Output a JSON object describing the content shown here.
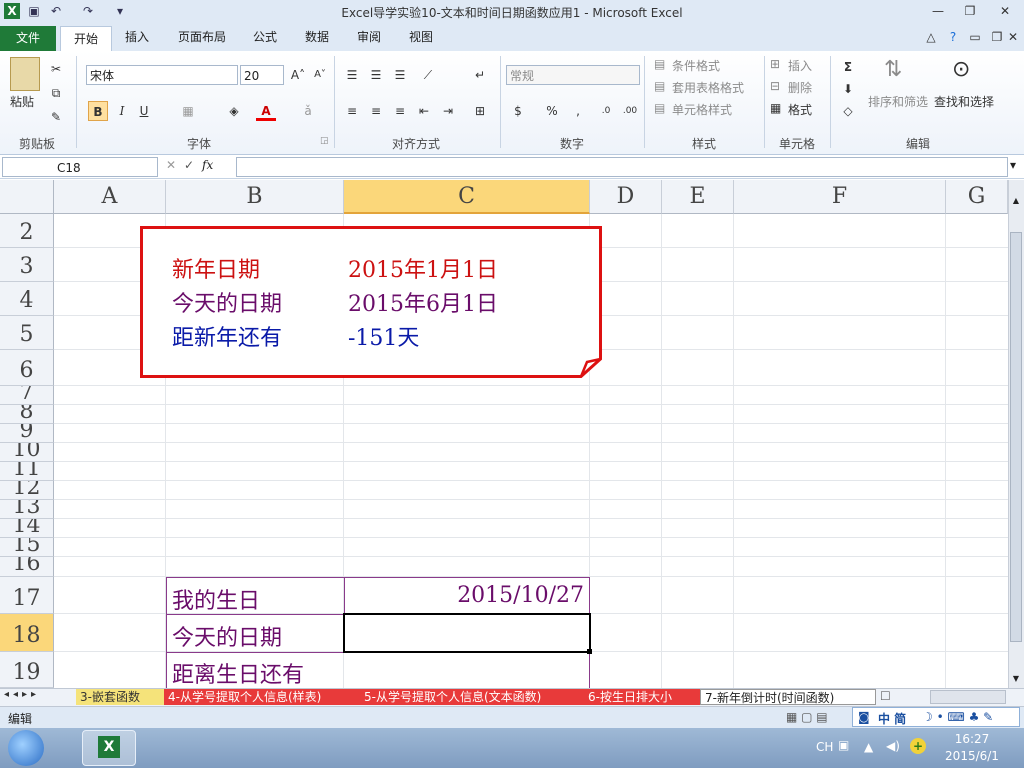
{
  "window": {
    "title": "Excel导学实验10-文本和时间日期函数应用1 - Microsoft Excel"
  },
  "ribbon_tabs": [
    "文件",
    "开始",
    "插入",
    "页面布局",
    "公式",
    "数据",
    "审阅",
    "视图"
  ],
  "ribbon": {
    "clipboard": {
      "label": "剪贴板",
      "paste": "粘贴"
    },
    "font": {
      "label": "字体",
      "name": "宋体",
      "size": "20",
      "bold": "B",
      "italic": "I",
      "underline": "U"
    },
    "alignment": {
      "label": "对齐方式"
    },
    "number": {
      "label": "数字",
      "format": "常规",
      "percent": "%"
    },
    "styles": {
      "label": "样式",
      "conditional": "条件格式",
      "table": "套用表格格式",
      "cell_styles": "单元格样式"
    },
    "cells": {
      "label": "单元格",
      "insert": "插入",
      "delete": "删除",
      "format": "格式"
    },
    "editing": {
      "label": "编辑",
      "sort": "排序和筛选",
      "find": "查找和选择"
    }
  },
  "formula_bar": {
    "name_box": "C18",
    "fx": "fx",
    "value": ""
  },
  "columns": [
    "A",
    "B",
    "C",
    "D",
    "E",
    "F",
    "G"
  ],
  "rows": [
    "2",
    "3",
    "4",
    "5",
    "6",
    "7",
    "8",
    "9",
    "10",
    "11",
    "12",
    "13",
    "14",
    "15",
    "16",
    "17",
    "18",
    "19"
  ],
  "callout": {
    "rows": [
      {
        "label": "新年日期",
        "value": "2015年1月1日",
        "color": "#cc1111"
      },
      {
        "label": "今天的日期",
        "value": "2015年6月1日",
        "color": "#6a0d6a"
      },
      {
        "label": "距新年还有",
        "value": "-151天",
        "color": "#0a1aa8"
      }
    ],
    "border_color": "#dd1111"
  },
  "table": {
    "color": "#6a0d6a",
    "rows": [
      {
        "label": "我的生日",
        "value": "2015/10/27"
      },
      {
        "label": "今天的日期",
        "value": ""
      },
      {
        "label": "距离生日还有",
        "value": ""
      }
    ]
  },
  "sheet_tabs": [
    {
      "label": "3-嵌套函数",
      "color": "#f5e37a",
      "active": false
    },
    {
      "label": "4-从学号提取个人信息(样表)",
      "color": "#e83a3a",
      "active": false
    },
    {
      "label": "5-从学号提取个人信息(文本函数)",
      "color": "#e83a3a",
      "active": false
    },
    {
      "label": "6-按生日排大小",
      "color": "#e83a3a",
      "active": false
    },
    {
      "label": "7-新年倒计时(时间函数)",
      "color": "#ffffff",
      "active": true
    }
  ],
  "status": {
    "mode": "编辑",
    "ime": "中 简"
  },
  "taskbar": {
    "lang": "CH",
    "time": "16:27",
    "date": "2015/6/1"
  }
}
